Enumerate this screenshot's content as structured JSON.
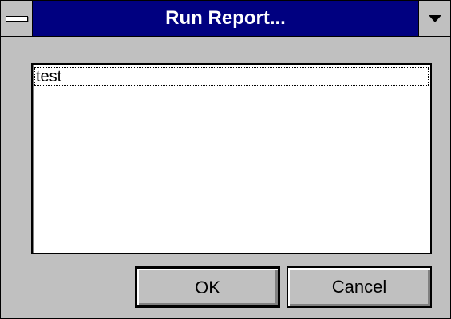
{
  "window": {
    "title": "Run Report..."
  },
  "titlebar": {
    "system_menu_icon": "system-menu-icon",
    "minimize_icon": "minimize-arrow-icon"
  },
  "report_list": {
    "items": [
      {
        "label": "test",
        "selected": true
      }
    ]
  },
  "buttons": {
    "ok_label": "OK",
    "cancel_label": "Cancel"
  },
  "colors": {
    "titlebar": "#000080",
    "face": "#c0c0c0",
    "list_bg": "#ffffff"
  }
}
